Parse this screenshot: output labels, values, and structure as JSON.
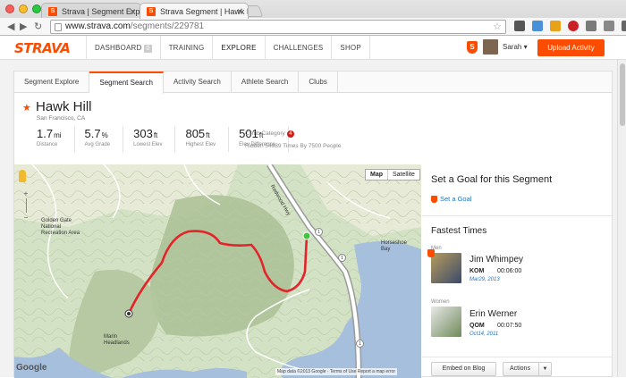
{
  "browser": {
    "tabs": [
      {
        "title": "Strava | Segment Explore",
        "active": false
      },
      {
        "title": "Strava Segment | Hawk Hill",
        "active": true
      }
    ],
    "url_host": "www.strava.com",
    "url_path": "/segments/229781"
  },
  "nav": {
    "logo": "STRAVA",
    "items": [
      "DASHBOARD",
      "TRAINING",
      "EXPLORE",
      "CHALLENGES",
      "SHOP"
    ],
    "dashboard_badge": "0",
    "username": "Sarah",
    "upload_label": "Upload Activity",
    "accent": "#fc4c02"
  },
  "page_tabs": [
    "Segment Explore",
    "Segment Search",
    "Activity Search",
    "Athlete Search",
    "Clubs"
  ],
  "segment": {
    "name": "Hawk Hill",
    "location": "San Francisco, CA",
    "stats": [
      {
        "value": "1.7",
        "unit": "mi",
        "label": "Distance"
      },
      {
        "value": "5.7",
        "unit": "%",
        "label": "Avg Grade"
      },
      {
        "value": "303",
        "unit": "ft",
        "label": "Lowest Elev"
      },
      {
        "value": "805",
        "unit": "ft",
        "label": "Highest Elev"
      },
      {
        "value": "501",
        "unit": "ft",
        "label": "Elev Difference"
      }
    ],
    "climb_label": "Climb Category",
    "climb_value": "4",
    "ridden": "Ridden 54989 Times By 7500 People"
  },
  "map": {
    "type_map": "Map",
    "type_satellite": "Satellite",
    "google": "Google",
    "footer": "Map data ©2013 Google · Terms of Use",
    "report": "Report a map error",
    "labels": {
      "ggnra": "Golden Gate\nNational\nRecreation Area",
      "redwood": "Redwood Hwy",
      "horseshoe": "Horseshoe\nBay",
      "headlands": "Marin\nHeadlands"
    },
    "route_color": "#e3242b"
  },
  "side": {
    "goal_heading": "Set a Goal for this Segment",
    "goal_link": "Set a Goal",
    "fastest_heading": "Fastest Times",
    "men_label": "Men",
    "women_label": "Women",
    "men": {
      "name": "Jim Whimpey",
      "rank": "KOM",
      "time": "00:06:00",
      "date": "Mar29, 2013"
    },
    "women": {
      "name": "Erin Werner",
      "rank": "QOM",
      "time": "00:07:50",
      "date": "Oct14, 2011"
    },
    "embed_label": "Embed on Blog",
    "actions_label": "Actions"
  }
}
